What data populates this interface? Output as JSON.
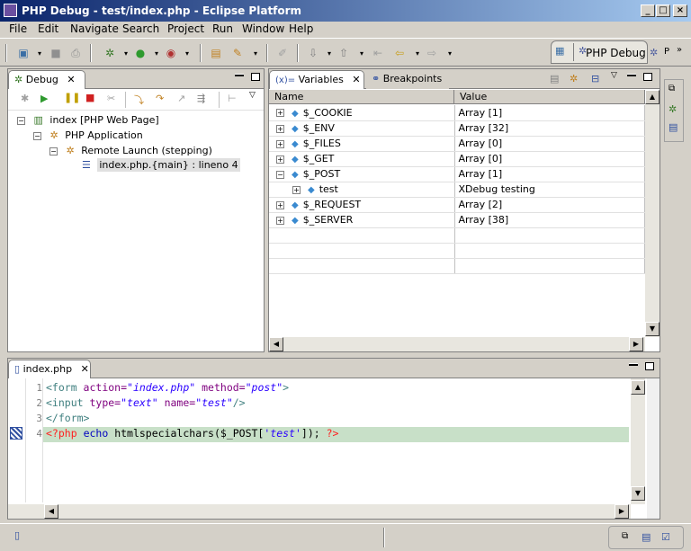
{
  "window": {
    "title": "PHP Debug - test/index.php - Eclipse Platform"
  },
  "menu": [
    "File",
    "Edit",
    "Navigate",
    "Search",
    "Project",
    "Run",
    "Window",
    "Help"
  ],
  "perspective": {
    "label": "PHP Debug"
  },
  "debug_view": {
    "tab": "Debug",
    "tree": [
      {
        "label": "index [PHP Web Page]"
      },
      {
        "label": "PHP Application"
      },
      {
        "label": "Remote Launch (stepping)"
      },
      {
        "label": "index.php.{main} : lineno 4"
      }
    ]
  },
  "variables_view": {
    "tab_variables": "Variables",
    "tab_breakpoints": "Breakpoints",
    "columns": [
      "Name",
      "Value"
    ],
    "rows": [
      {
        "name": "$_COOKIE",
        "value": "Array [1]"
      },
      {
        "name": "$_ENV",
        "value": "Array [32]"
      },
      {
        "name": "$_FILES",
        "value": "Array [0]"
      },
      {
        "name": "$_GET",
        "value": "Array [0]"
      },
      {
        "name": "$_POST",
        "value": "Array [1]"
      },
      {
        "name": "test",
        "value": "XDebug testing"
      },
      {
        "name": "$_REQUEST",
        "value": "Array [2]"
      },
      {
        "name": "$_SERVER",
        "value": "Array [38]"
      }
    ]
  },
  "editor": {
    "tab": "index.php",
    "lines": [
      {
        "num": "1",
        "parts": [
          [
            "tag",
            "<form "
          ],
          [
            "attr",
            "action="
          ],
          [
            "str",
            "\"index.php\""
          ],
          [
            "plain",
            " "
          ],
          [
            "attr",
            "method="
          ],
          [
            "str",
            "\"post\""
          ],
          [
            "tag",
            ">"
          ]
        ]
      },
      {
        "num": "2",
        "parts": [
          [
            "tag",
            "<input "
          ],
          [
            "attr",
            "type="
          ],
          [
            "str",
            "\"text\""
          ],
          [
            "plain",
            " "
          ],
          [
            "attr",
            "name="
          ],
          [
            "str",
            "\"test\""
          ],
          [
            "tag",
            "/>"
          ]
        ]
      },
      {
        "num": "3",
        "parts": [
          [
            "tag",
            "</form>"
          ]
        ]
      },
      {
        "num": "4",
        "parts": [
          [
            "php",
            "<?php"
          ],
          [
            "plain",
            " "
          ],
          [
            "kw",
            "echo"
          ],
          [
            "plain",
            " htmlspecialchars($_POST["
          ],
          [
            "sq",
            "'test'"
          ],
          [
            "plain",
            "]); "
          ],
          [
            "php",
            "?>"
          ]
        ]
      }
    ]
  }
}
